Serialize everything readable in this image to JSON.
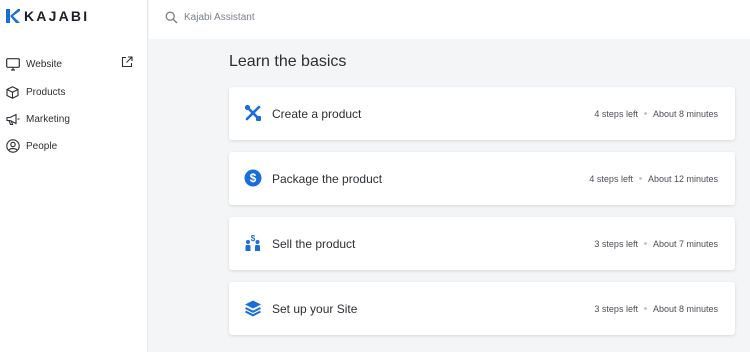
{
  "brand": {
    "name": "KAJABI",
    "color": "#1a6ed8"
  },
  "search": {
    "placeholder": "Kajabi Assistant"
  },
  "sidebar": {
    "items": [
      {
        "label": "Website",
        "icon": "monitor-icon",
        "external": true
      },
      {
        "label": "Products",
        "icon": "box-icon"
      },
      {
        "label": "Marketing",
        "icon": "megaphone-icon"
      },
      {
        "label": "People",
        "icon": "user-circle-icon"
      }
    ]
  },
  "main": {
    "title": "Learn the basics",
    "cards": [
      {
        "title": "Create a product",
        "steps": "4 steps left",
        "time": "About 8 minutes",
        "icon": "tools-icon"
      },
      {
        "title": "Package the product",
        "steps": "4 steps left",
        "time": "About 12 minutes",
        "icon": "dollar-icon"
      },
      {
        "title": "Sell the product",
        "steps": "3 steps left",
        "time": "About 7 minutes",
        "icon": "people-icon"
      },
      {
        "title": "Set up your Site",
        "steps": "3 steps left",
        "time": "About 8 minutes",
        "icon": "layers-icon"
      }
    ]
  },
  "colors": {
    "accent": "#1a6ed8",
    "background": "#f4f5f7",
    "card": "#ffffff",
    "text": "#2b2f33"
  }
}
